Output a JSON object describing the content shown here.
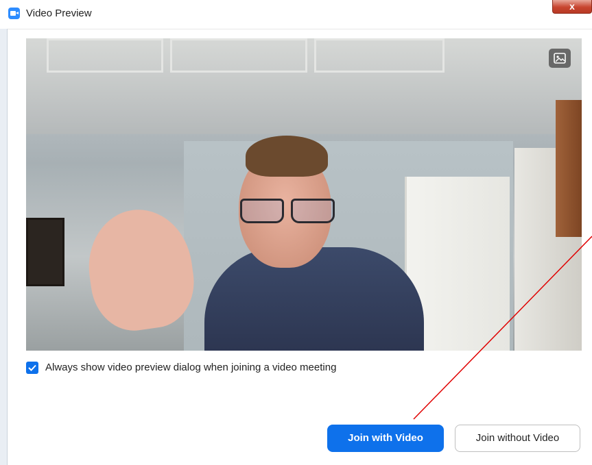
{
  "window": {
    "title": "Video Preview",
    "close_label": "x"
  },
  "preview": {
    "checkbox_checked": true,
    "checkbox_label": "Always show video preview dialog when joining a video meeting"
  },
  "buttons": {
    "join_with_video": "Join with Video",
    "join_without_video": "Join without Video"
  },
  "colors": {
    "accent": "#0e71eb",
    "annotation": "#e00000"
  },
  "icons": {
    "app": "zoom-camera-icon",
    "pip": "picture-in-picture-icon",
    "close": "close-icon"
  }
}
